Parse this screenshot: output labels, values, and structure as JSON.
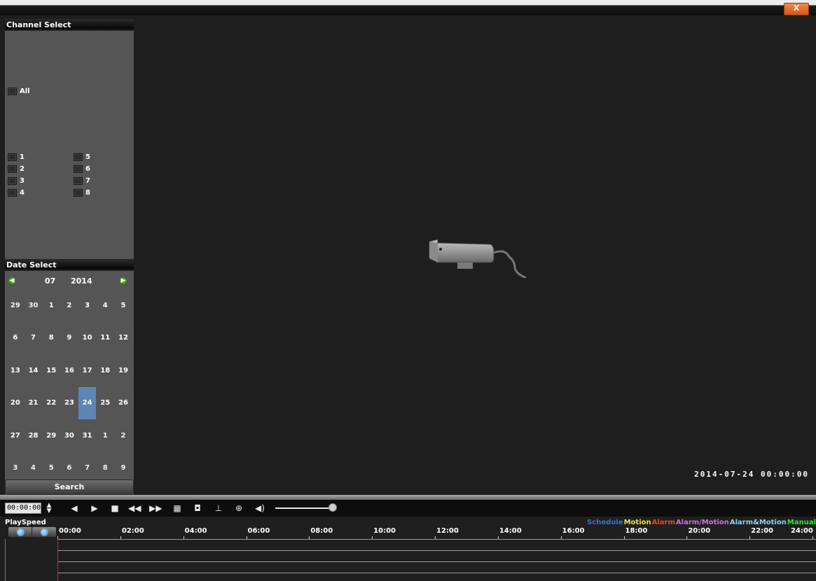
{
  "window": {
    "close_label": "X"
  },
  "channel_select": {
    "title": "Channel Select",
    "all_label": "All",
    "channels": [
      "1",
      "2",
      "3",
      "4",
      "5",
      "6",
      "7",
      "8"
    ]
  },
  "date_select": {
    "title": "Date Select",
    "month": "07",
    "year": "2014",
    "weeks": [
      [
        "29",
        "30",
        "1",
        "2",
        "3",
        "4",
        "5"
      ],
      [
        "6",
        "7",
        "8",
        "9",
        "10",
        "11",
        "12"
      ],
      [
        "13",
        "14",
        "15",
        "16",
        "17",
        "18",
        "19"
      ],
      [
        "20",
        "21",
        "22",
        "23",
        "24",
        "25",
        "26"
      ],
      [
        "27",
        "28",
        "29",
        "30",
        "31",
        "1",
        "2"
      ],
      [
        "3",
        "4",
        "5",
        "6",
        "7",
        "8",
        "9"
      ]
    ],
    "selected_day": "24",
    "search_label": "Search"
  },
  "video": {
    "timestamp": "2014-07-24 00:00:00"
  },
  "controls": {
    "time_value": "00:00:00",
    "volume_level": 0.95
  },
  "timeline": {
    "playspeed_label": "PlaySpeed",
    "hours": [
      "00:00",
      "02:00",
      "04:00",
      "06:00",
      "08:00",
      "10:00",
      "12:00",
      "14:00",
      "16:00",
      "18:00",
      "20:00",
      "22:00",
      "24:00"
    ],
    "legend": [
      {
        "label": "Schedule",
        "color": "#3a6fd8"
      },
      {
        "label": "Motion",
        "color": "#f0e040"
      },
      {
        "label": "Alarm",
        "color": "#e04a2a"
      },
      {
        "label": "Alarm/Motion",
        "color": "#d070e0"
      },
      {
        "label": "Alarm&Motion",
        "color": "#8fd0f0"
      },
      {
        "label": "Manual",
        "color": "#2ee82e"
      }
    ]
  },
  "colors": {
    "selected_day": "#5d86b4",
    "panel_bg": "#555555",
    "video_bg": "#1e1e1e"
  }
}
